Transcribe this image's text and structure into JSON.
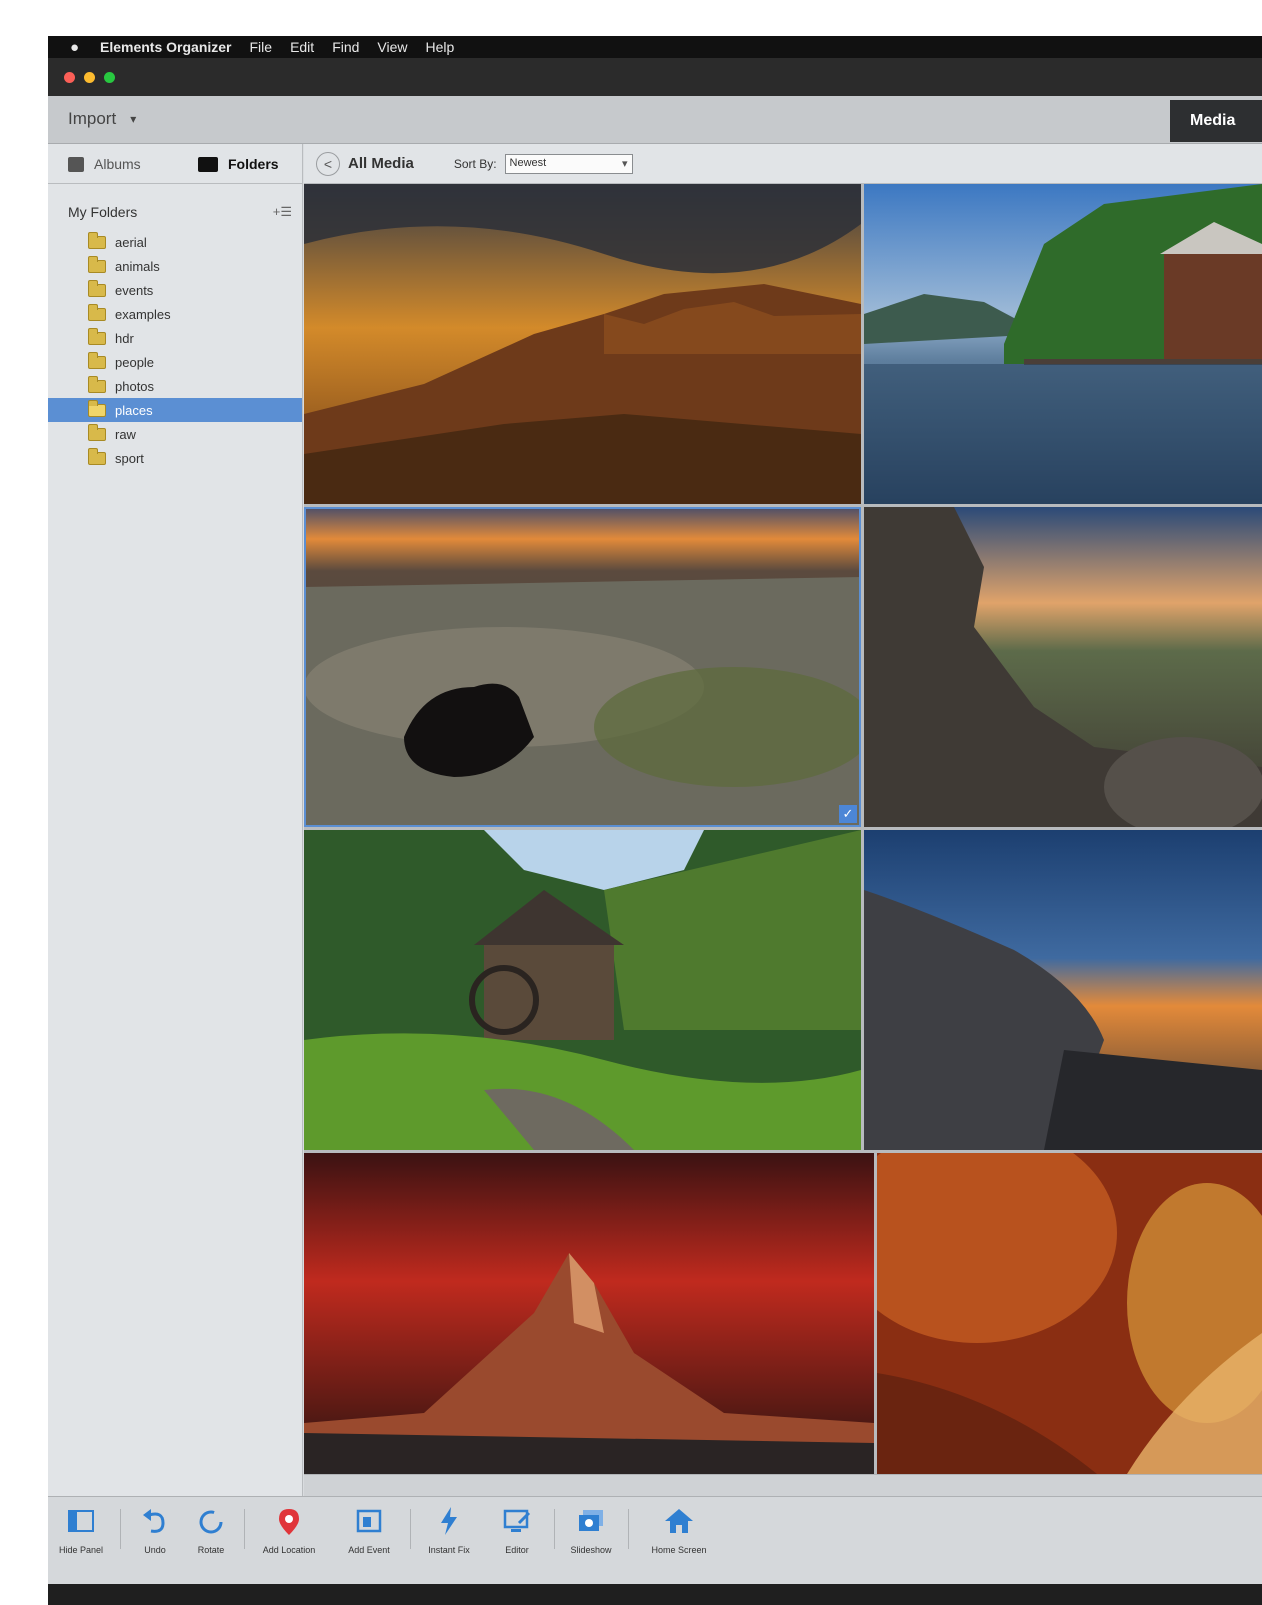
{
  "menubar": {
    "app_name": "Elements Organizer",
    "items": [
      "File",
      "Edit",
      "Find",
      "View",
      "Help"
    ]
  },
  "topbar": {
    "import_label": "Import",
    "media_tab_label": "Media"
  },
  "sidebar": {
    "albums_label": "Albums",
    "folders_label": "Folders",
    "my_folders_label": "My Folders",
    "folders": [
      "aerial",
      "animals",
      "events",
      "examples",
      "hdr",
      "people",
      "photos",
      "places",
      "raw",
      "sport"
    ],
    "selected_folder": "places"
  },
  "content_bar": {
    "all_media_label": "All Media",
    "sort_label": "Sort By:",
    "sort_value": "Newest"
  },
  "toolbar": {
    "hide_panel": "Hide Panel",
    "undo": "Undo",
    "rotate": "Rotate",
    "add_location": "Add Location",
    "add_event": "Add Event",
    "instant_fix": "Instant Fix",
    "editor": "Editor",
    "slideshow": "Slideshow",
    "home_screen": "Home Screen"
  },
  "icons": {
    "traffic_lights": [
      "close-icon",
      "minimize-icon",
      "zoom-icon"
    ],
    "accent": "#5b8fd3",
    "location_pin": "#e0353a",
    "tool_blue": "#2f7fd1"
  }
}
